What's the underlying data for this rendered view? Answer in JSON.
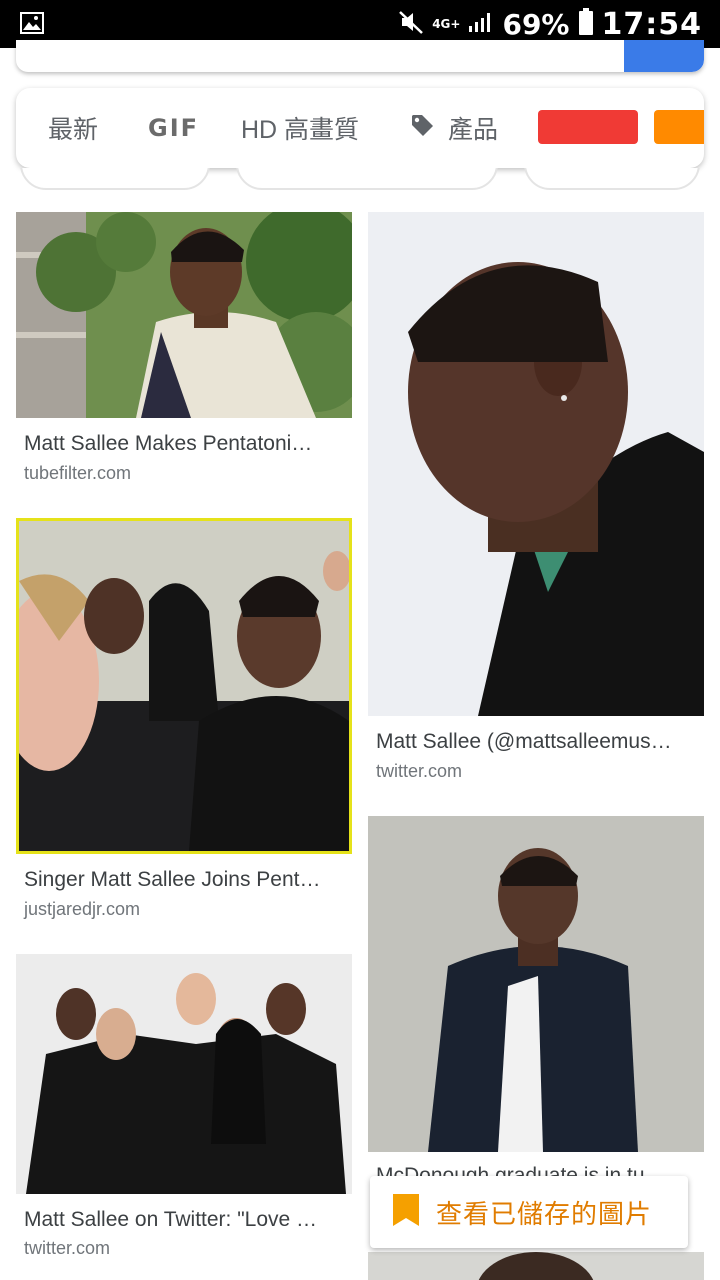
{
  "status_bar": {
    "battery_percent": "69%",
    "time": "17:54",
    "network": "4G+",
    "icons": [
      "gallery-icon",
      "mute-icon",
      "signal-icon",
      "battery-icon"
    ]
  },
  "filters": {
    "latest": "最新",
    "gif": "GIF",
    "hd": "HD 高畫質",
    "products": "產品",
    "colors": [
      "#f03a35",
      "#ff8a00"
    ]
  },
  "results": [
    {
      "title": "Matt Sallee Makes Pentatoni…",
      "site": "tubefilter.com"
    },
    {
      "title": "Matt Sallee (@mattsalleemus…",
      "site": "twitter.com"
    },
    {
      "title": "Singer Matt Sallee Joins Pent…",
      "site": "justjaredjr.com"
    },
    {
      "title": "McDonough graduate is in tu…",
      "site": ""
    },
    {
      "title": "Matt Sallee on Twitter: \"Love …",
      "site": "twitter.com"
    }
  ],
  "saved_button": {
    "label": "查看已儲存的圖片"
  }
}
